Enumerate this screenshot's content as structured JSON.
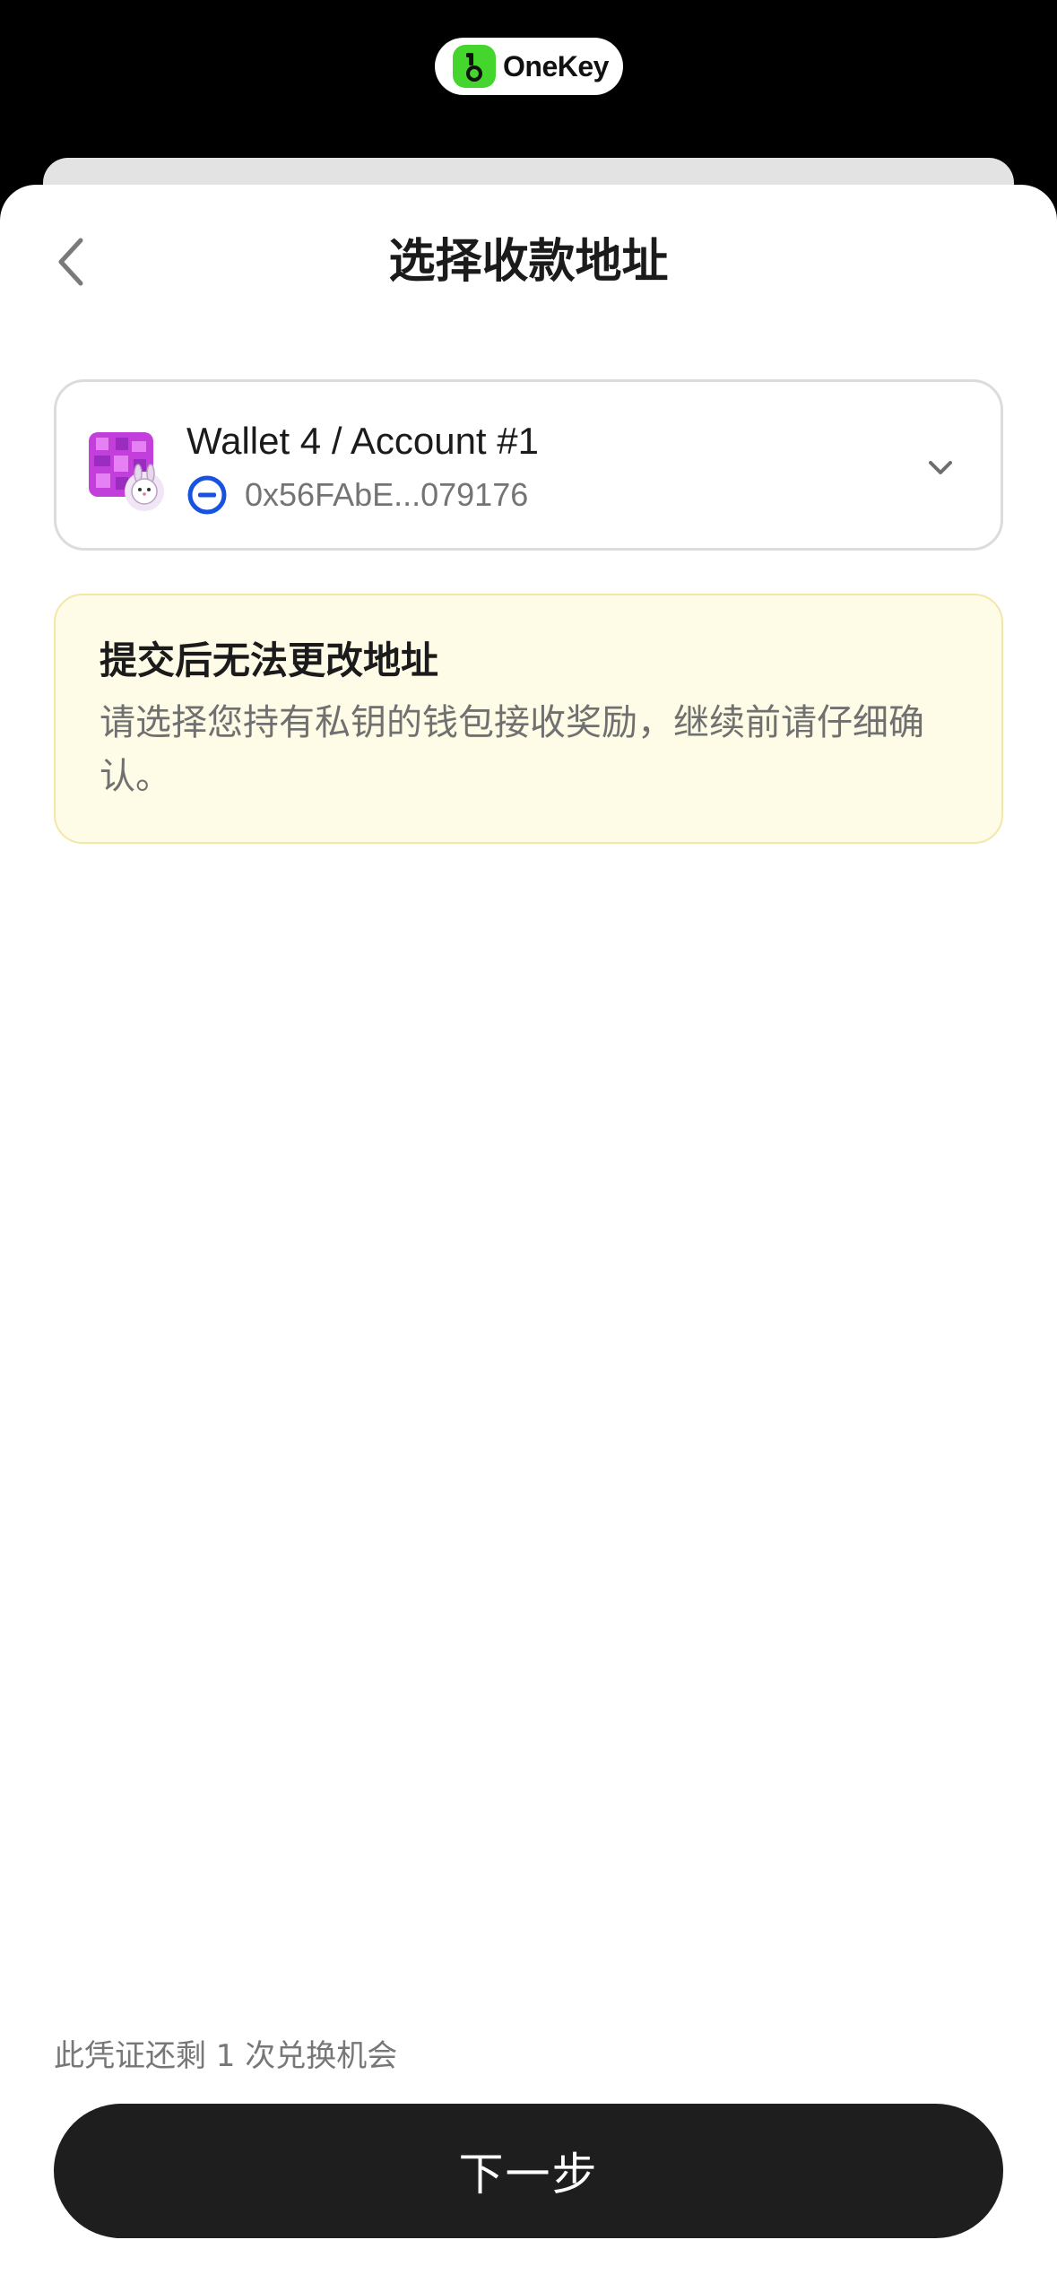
{
  "brand": {
    "name": "OneKey"
  },
  "header": {
    "title": "选择收款地址"
  },
  "account": {
    "name": "Wallet 4 / Account #1",
    "address": "0x56FAbE...079176"
  },
  "warning": {
    "title": "提交后无法更改地址",
    "body": "请选择您持有私钥的钱包接收奖励，继续前请仔细确认。"
  },
  "footer": {
    "redeem_note": "此凭证还剩 1 次兑换机会",
    "next_label": "下一步"
  },
  "colors": {
    "brand_green": "#44d62c",
    "chain_blue": "#1a52e0",
    "warning_bg": "#fefbe6",
    "button_bg": "#1e1e1e"
  }
}
